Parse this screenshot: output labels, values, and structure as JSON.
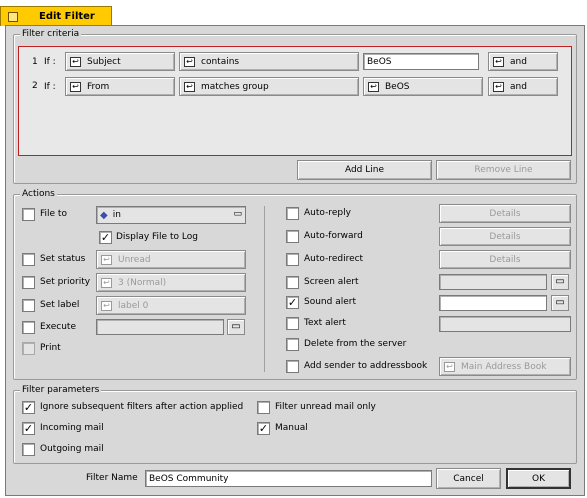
{
  "window": {
    "title": "Edit Filter"
  },
  "criteria": {
    "legend": "Filter criteria",
    "rows": [
      {
        "num": "1",
        "if": "If :",
        "field": "Subject",
        "op": "contains",
        "value": "BeOS",
        "logic": "and"
      },
      {
        "num": "2",
        "if": "If :",
        "field": "From",
        "op": "matches group",
        "value": "BeOS",
        "logic": "and"
      }
    ],
    "add_line": "Add Line",
    "remove_line": "Remove Line"
  },
  "actions": {
    "legend": "Actions",
    "file_to": {
      "label": "File to",
      "folder": "in",
      "checked": false
    },
    "display_file_to_log": {
      "label": "Display File to Log",
      "checked": true
    },
    "set_status": {
      "label": "Set status",
      "value": "Unread"
    },
    "set_priority": {
      "label": "Set priority",
      "value": "3 (Normal)"
    },
    "set_label": {
      "label": "Set label",
      "value": "label 0"
    },
    "execute": {
      "label": "Execute",
      "value": ""
    },
    "print": {
      "label": "Print"
    },
    "auto_reply": {
      "label": "Auto-reply",
      "details": "Details"
    },
    "auto_forward": {
      "label": "Auto-forward",
      "details": "Details"
    },
    "auto_redirect": {
      "label": "Auto-redirect",
      "details": "Details"
    },
    "screen_alert": {
      "label": "Screen alert"
    },
    "sound_alert": {
      "label": "Sound alert",
      "checked": true
    },
    "text_alert": {
      "label": "Text alert"
    },
    "delete_server": {
      "label": "Delete from the server"
    },
    "add_sender": {
      "label": "Add sender to addressbook",
      "book": "Main Address Book"
    }
  },
  "params": {
    "legend": "Filter parameters",
    "ignore_subsequent": {
      "label": "Ignore subsequent filters after action applied",
      "checked": true
    },
    "unread_only": {
      "label": "Filter unread mail only",
      "checked": false
    },
    "incoming": {
      "label": "Incoming mail",
      "checked": true
    },
    "manual": {
      "label": "Manual",
      "checked": true
    },
    "outgoing": {
      "label": "Outgoing mail",
      "checked": false
    }
  },
  "footer": {
    "name_label": "Filter Name",
    "name_value": "BeOS Community",
    "cancel": "Cancel",
    "ok": "OK"
  },
  "icons": {
    "menu": "menu-arrow-icon",
    "file": "file-icon",
    "folder": "folder-icon"
  }
}
